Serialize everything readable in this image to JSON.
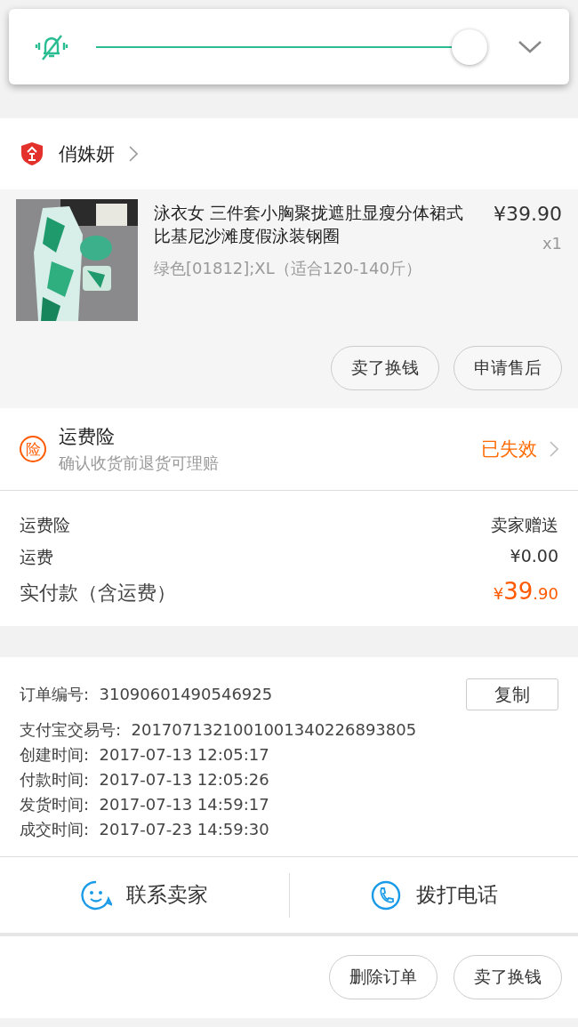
{
  "volume_popup": {
    "muted": true,
    "level": 1.0
  },
  "shop": {
    "name": "俏姝妍"
  },
  "product": {
    "kind": "picture",
    "title": "泳衣女 三件套小胸聚拢遮肚显瘦分体裙式比基尼沙滩度假泳装钢圈",
    "variant": "绿色[01812];XL（适合120-140斤）",
    "price": "¥39.90",
    "quantity": "x1",
    "buttons": [
      "卖了换钱",
      "申请售后"
    ]
  },
  "insurance": {
    "badge": "险",
    "title": "运费险",
    "subtitle": "确认收货前退货可理赔",
    "status": "已失效"
  },
  "fees": [
    {
      "label": "运费险",
      "value": "卖家赠送"
    },
    {
      "label": "运费",
      "value": "¥0.00"
    }
  ],
  "total": {
    "label": "实付款（含运费）",
    "currency": "¥",
    "integer": "39",
    "decimal": ".90"
  },
  "order_info": [
    {
      "label": "订单编号:",
      "value": "31090601490546925"
    },
    {
      "label": "支付宝交易号:",
      "value": "2017071321001001340226893805"
    },
    {
      "label": "创建时间:",
      "value": "2017-07-13 12:05:17"
    },
    {
      "label": "付款时间:",
      "value": "2017-07-13 12:05:26"
    },
    {
      "label": "发货时间:",
      "value": "2017-07-13 14:59:17"
    },
    {
      "label": "成交时间:",
      "value": "2017-07-23 14:59:30"
    }
  ],
  "copy_button": "复制",
  "contact": [
    {
      "kind": "chat",
      "label": "联系卖家"
    },
    {
      "kind": "phone",
      "label": "拨打电话"
    }
  ],
  "bottom_buttons": [
    "删除订单",
    "卖了换钱"
  ]
}
